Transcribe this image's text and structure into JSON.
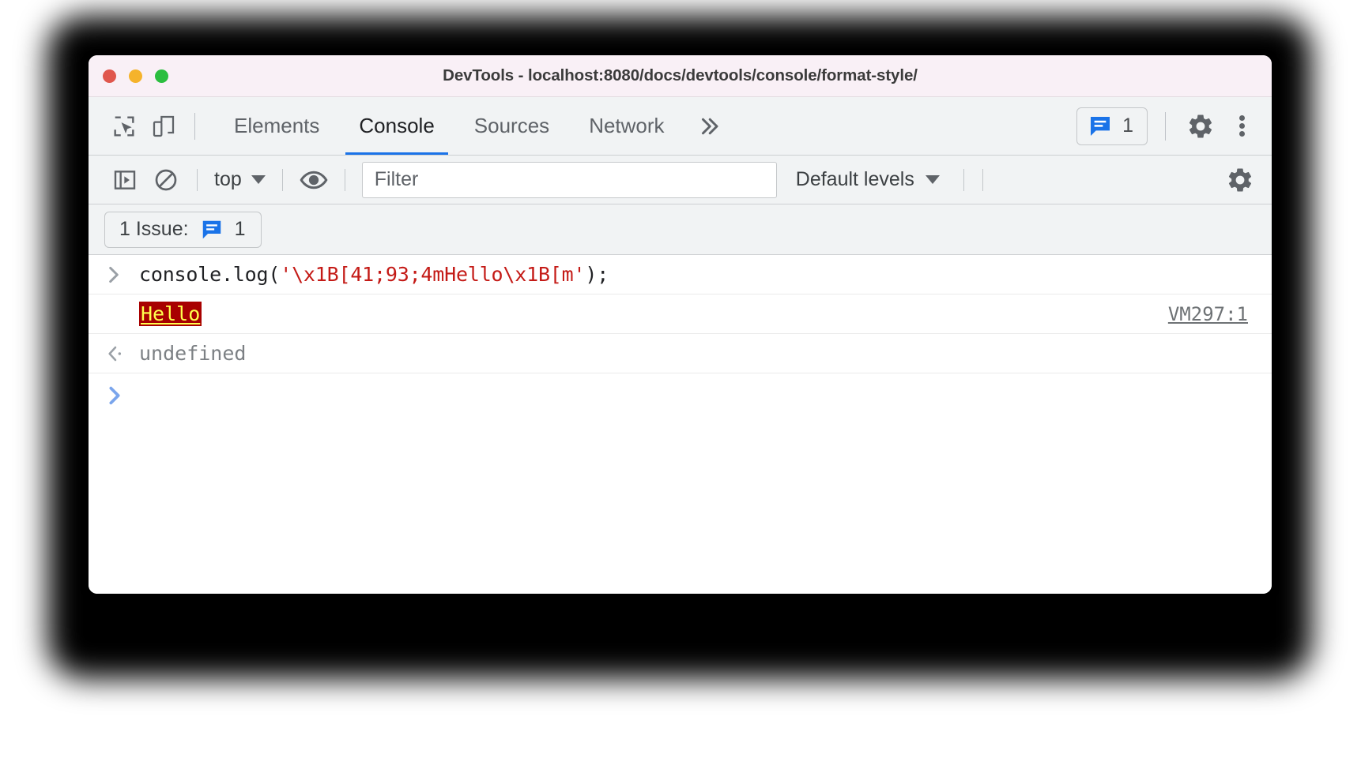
{
  "window": {
    "title": "DevTools - localhost:8080/docs/devtools/console/format-style/",
    "traffic_lights": [
      {
        "name": "close",
        "color": "#e0574d"
      },
      {
        "name": "minimize",
        "color": "#f5b32b"
      },
      {
        "name": "zoom",
        "color": "#2bbe3f"
      }
    ]
  },
  "toolbar": {
    "inspect_icon": "inspect-element-icon",
    "device_icon": "device-toolbar-icon",
    "tabs": [
      {
        "label": "Elements",
        "active": false
      },
      {
        "label": "Console",
        "active": true
      },
      {
        "label": "Sources",
        "active": false
      },
      {
        "label": "Network",
        "active": false
      }
    ],
    "more_tabs_icon": "chevron-double-right-icon",
    "issues_badge": {
      "icon": "issue-message-icon",
      "count": "1",
      "color": "#1a73e8"
    },
    "settings_icon": "gear-icon",
    "more_options_icon": "kebab-menu-icon"
  },
  "console_toolbar": {
    "sidebar_toggle_icon": "console-sidebar-icon",
    "clear_console_icon": "clear-console-icon",
    "context": {
      "label": "top",
      "caret_icon": "chevron-down-icon"
    },
    "live_expression_icon": "eye-icon",
    "filter": {
      "placeholder": "Filter",
      "value": ""
    },
    "levels": {
      "label": "Default levels",
      "caret_icon": "chevron-down-icon"
    },
    "settings_icon": "gear-icon"
  },
  "issues_bar": {
    "label": "1 Issue:",
    "icon": "issue-message-icon",
    "count": "1"
  },
  "console": {
    "input_row": {
      "prompt_icon": "chevron-right-icon",
      "code_prefix": "console.log(",
      "code_string": "'\\x1B[41;93;4mHello\\x1B[m'",
      "code_suffix": ");"
    },
    "output_row": {
      "text": "Hello",
      "background_color": "#a80000",
      "text_color": "#ffff4d",
      "underline": true,
      "source_link": "VM297:1"
    },
    "result_row": {
      "return_icon": "return-arrow-icon",
      "value": "undefined"
    },
    "prompt_row": {
      "prompt_icon": "chevron-right-icon",
      "value": ""
    }
  }
}
